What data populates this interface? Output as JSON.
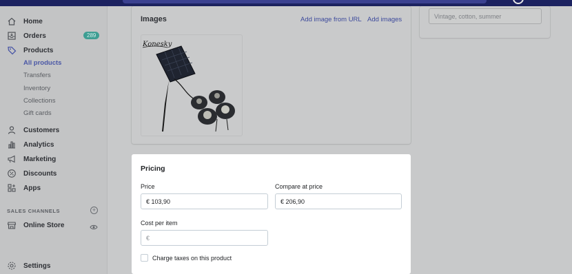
{
  "sidebar": {
    "items": [
      {
        "label": "Home",
        "icon": "home-icon"
      },
      {
        "label": "Orders",
        "icon": "orders-icon",
        "badge": "289"
      },
      {
        "label": "Products",
        "icon": "tag-icon"
      },
      {
        "label": "Customers",
        "icon": "person-icon"
      },
      {
        "label": "Analytics",
        "icon": "bar-chart-icon"
      },
      {
        "label": "Marketing",
        "icon": "megaphone-icon"
      },
      {
        "label": "Discounts",
        "icon": "discount-icon"
      },
      {
        "label": "Apps",
        "icon": "apps-icon"
      }
    ],
    "product_sub": [
      "All products",
      "Transfers",
      "Inventory",
      "Collections",
      "Gift cards"
    ],
    "sales_channels_heading": "SALES CHANNELS",
    "online_store": "Online Store",
    "settings": "Settings"
  },
  "images": {
    "title": "Images",
    "add_from_url": "Add image from URL",
    "add_images": "Add images",
    "logo_text": "Konesky"
  },
  "tags": {
    "placeholder": "Vintage, cotton, summer"
  },
  "pricing": {
    "title": "Pricing",
    "price_label": "Price",
    "price_value": "€ 103,90",
    "compare_label": "Compare at price",
    "compare_value": "€ 206,90",
    "cost_label": "Cost per item",
    "cost_placeholder": "€",
    "charge_taxes_label": "Charge taxes on this product"
  },
  "colors": {
    "accent": "#4a57a6",
    "badge": "#3e9e93",
    "topbar": "#1c2260"
  }
}
